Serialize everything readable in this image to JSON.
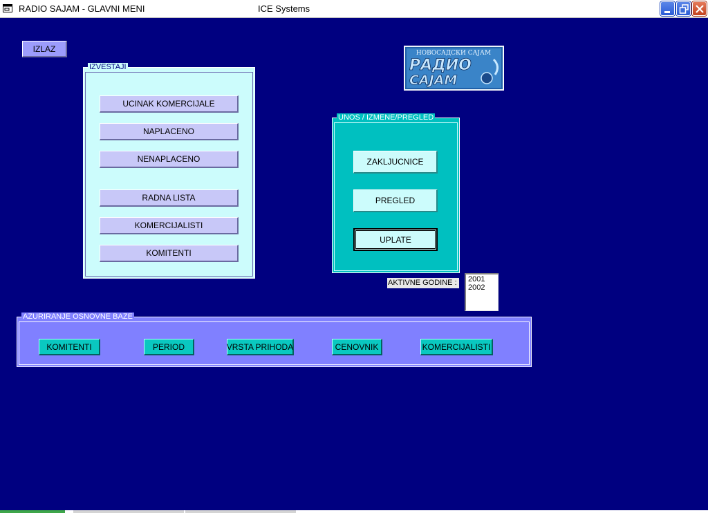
{
  "window": {
    "title": "RADIO SAJAM - GLAVNI MENI",
    "subtitle": "ICE Systems"
  },
  "izlaz_label": "IZLAZ",
  "logo": {
    "line1": "НОВОСАДСКИ САЈАМ",
    "line2": "РАДИО",
    "line3": "САЈАМ"
  },
  "izvestaji": {
    "legend": "IZVESTAJI",
    "buttons": [
      "UCINAK KOMERCIJALE",
      "NAPLACENO",
      "NENAPLACENO",
      "RADNA LISTA",
      "KOMERCIJALISTI",
      "KOMITENTI"
    ]
  },
  "unos": {
    "legend": "UNOS / IZMENE/PREGLED",
    "buttons": [
      "ZAKLJUCNICE",
      "PREGLED",
      "UPLATE"
    ]
  },
  "aktivne": {
    "label": "AKTIVNE GODINE :",
    "options": [
      "2001",
      "2002"
    ]
  },
  "azuriranje": {
    "legend": "AZURIRANJE OSNOVNE BAZE",
    "buttons": [
      "KOMITENTI",
      "PERIOD",
      "VRSTA PRIHODA",
      "CENOVNIK",
      "KOMERCIJALISTI"
    ]
  },
  "colors": {
    "background": "#000080",
    "izvestaji_panel": "#ccfcfc",
    "unos_panel": "#00c0c0",
    "azuriranje_panel": "#8080ff",
    "lilac_button": "#c8c8f8",
    "teal_button": "#0ac8c0"
  }
}
